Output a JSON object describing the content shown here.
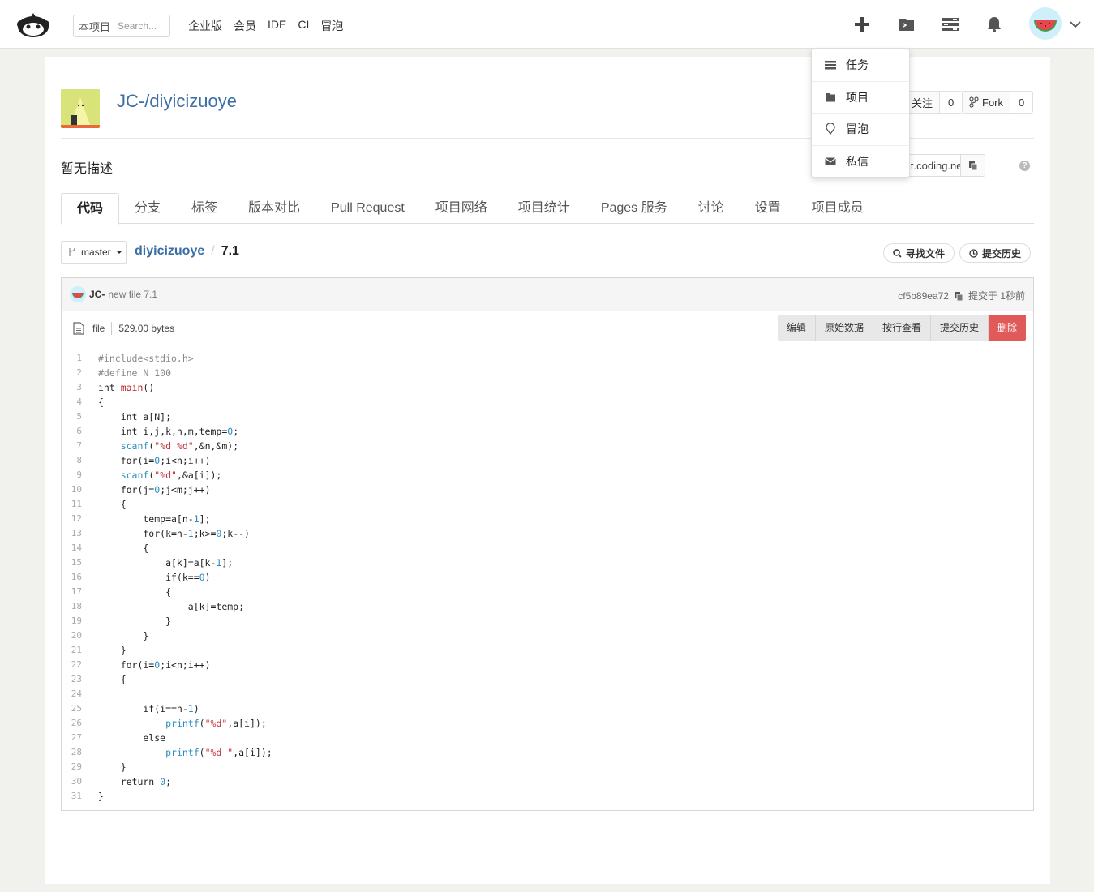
{
  "topnav": {
    "search_scope": "本项目",
    "search_placeholder": "Search...",
    "links": [
      "企业版",
      "会员",
      "IDE",
      "CI",
      "冒泡"
    ]
  },
  "dropdown": {
    "items": [
      "任务",
      "项目",
      "冒泡",
      "私信"
    ]
  },
  "project": {
    "title": "JC-/diyicizuoye",
    "description": "暂无描述",
    "watch_label": "关注",
    "watch_count": "0",
    "fork_label": "Fork",
    "fork_count": "0",
    "clone_url": "it.coding.net/JC"
  },
  "tabs": [
    "代码",
    "分支",
    "标签",
    "版本对比",
    "Pull Request",
    "项目网络",
    "项目统计",
    "Pages 服务",
    "讨论",
    "设置",
    "项目成员"
  ],
  "breadcrumb": {
    "branch": "master",
    "repo": "diyicizuoye",
    "separator": "/",
    "file": "7.1",
    "find_file": "寻找文件",
    "history": "提交历史"
  },
  "commit": {
    "author": "JC-",
    "message": "new file 7.1",
    "hash": "cf5b89ea72",
    "time": "提交于 1秒前"
  },
  "file_meta": {
    "type": "file",
    "size": "529.00 bytes",
    "actions": [
      "编辑",
      "原始数据",
      "按行查看",
      "提交历史"
    ],
    "delete": "删除"
  },
  "code_lines": [
    "#include<stdio.h>",
    "#define N 100",
    "int main()",
    "{",
    "    int a[N];",
    "    int i,j,k,n,m,temp=0;",
    "    scanf(\"%d %d\",&n,&m);",
    "    for(i=0;i<n;i++)",
    "    scanf(\"%d\",&a[i]);",
    "    for(j=0;j<m;j++)",
    "    {",
    "        temp=a[n-1];",
    "        for(k=n-1;k>=0;k--)",
    "        {",
    "            a[k]=a[k-1];",
    "            if(k==0)",
    "            {",
    "                a[k]=temp;",
    "            }",
    "        }",
    "    }",
    "    for(i=0;i<n;i++)",
    "    {",
    "",
    "        if(i==n-1)",
    "            printf(\"%d\",a[i]);",
    "        else",
    "            printf(\"%d \",a[i]);",
    "    }",
    "    return 0;",
    "}"
  ],
  "colors": {
    "link": "#3a6ea5",
    "danger": "#e05a5a",
    "keyword_fn": "#bb2222",
    "number": "#2a8bbf",
    "string": "#c0363e"
  }
}
